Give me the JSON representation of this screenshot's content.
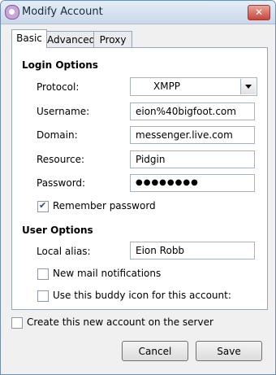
{
  "window": {
    "title": "Modify Account",
    "close_glyph": "✕"
  },
  "tabs": [
    {
      "label": "Basic",
      "active": true
    },
    {
      "label": "Advanced",
      "active": false
    },
    {
      "label": "Proxy",
      "active": false
    }
  ],
  "login_options": {
    "heading": "Login Options",
    "protocol": {
      "label": "Protocol:",
      "value": "XMPP"
    },
    "username": {
      "label": "Username:",
      "value": "eion%40bigfoot.com"
    },
    "domain": {
      "label": "Domain:",
      "value": "messenger.live.com"
    },
    "resource": {
      "label": "Resource:",
      "value": "Pidgin"
    },
    "password": {
      "label": "Password:",
      "value": "●●●●●●●●"
    },
    "remember_password": {
      "label": "Remember password",
      "checked": true
    }
  },
  "user_options": {
    "heading": "User Options",
    "local_alias": {
      "label": "Local alias:",
      "value": "Eion Robb"
    },
    "new_mail": {
      "label": "New mail notifications",
      "checked": false
    },
    "buddy_icon": {
      "label": "Use this buddy icon for this account:",
      "checked": false
    }
  },
  "create_account": {
    "label": "Create this new account on the server",
    "checked": false
  },
  "buttons": {
    "cancel": "Cancel",
    "save": "Save"
  }
}
